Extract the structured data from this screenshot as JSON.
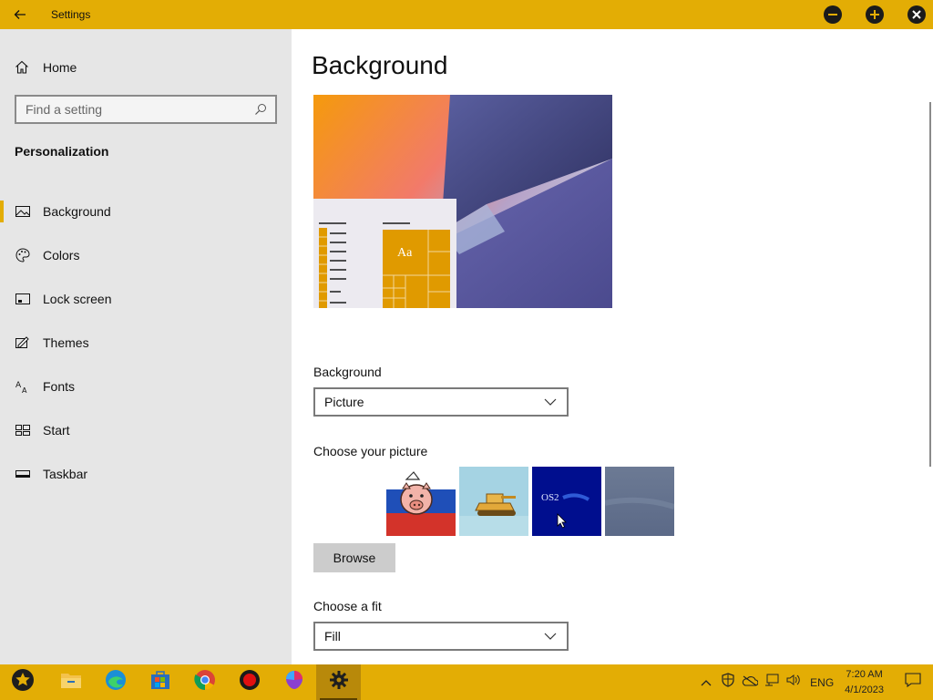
{
  "window": {
    "title": "Settings"
  },
  "sidebar": {
    "home_label": "Home",
    "search_placeholder": "Find a setting",
    "section_title": "Personalization",
    "items": [
      {
        "label": "Background",
        "icon": "picture-icon",
        "active": true
      },
      {
        "label": "Colors",
        "icon": "palette-icon"
      },
      {
        "label": "Lock screen",
        "icon": "lock-screen-icon"
      },
      {
        "label": "Themes",
        "icon": "themes-icon"
      },
      {
        "label": "Fonts",
        "icon": "fonts-icon"
      },
      {
        "label": "Start",
        "icon": "start-icon"
      },
      {
        "label": "Taskbar",
        "icon": "taskbar-icon"
      }
    ]
  },
  "main": {
    "title": "Background",
    "preview_tile_text": "Aa",
    "background_label": "Background",
    "background_value": "Picture",
    "choose_picture_label": "Choose your picture",
    "thumb_os2_text": "OS2",
    "browse_label": "Browse",
    "fit_label": "Choose a fit",
    "fit_value": "Fill"
  },
  "taskbar": {
    "language": "ENG",
    "time": "7:20 AM",
    "date": "4/1/2023"
  },
  "colors": {
    "accent": "#e3ad05",
    "sidebar": "#e6e6e6"
  }
}
